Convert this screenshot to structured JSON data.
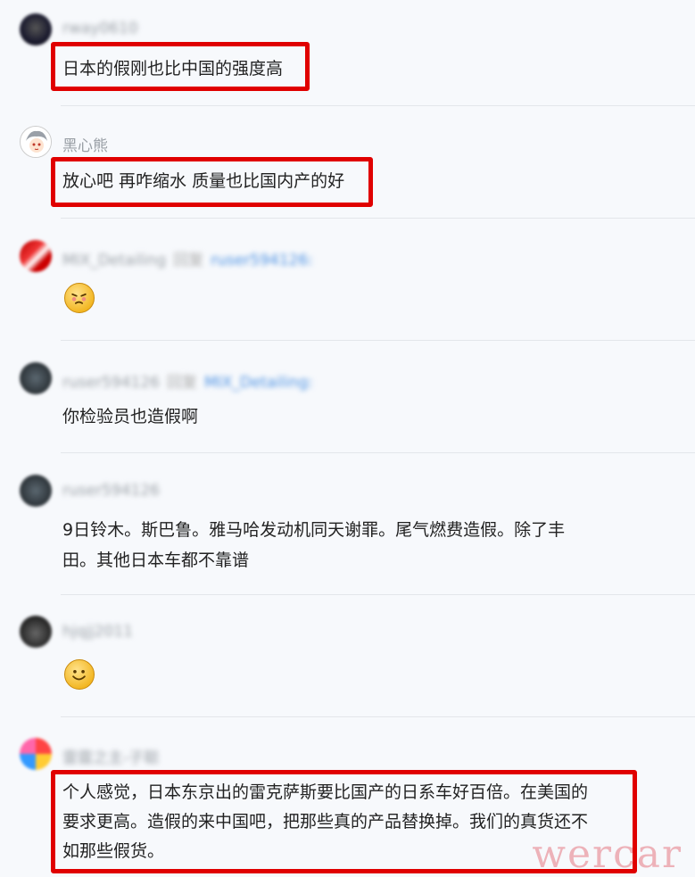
{
  "comments": [
    {
      "username": "rway0610",
      "text": "日本的假刚也比中国的强度高"
    },
    {
      "username": "黑心熊",
      "text": "放心吧 再咋缩水 质量也比国内产的好"
    },
    {
      "username": "MIX_Detailing",
      "reply_label": "回复",
      "reply_to": "ruser594126:",
      "emoji": "angry-face-emoji"
    },
    {
      "username": "ruser594126",
      "reply_label": "回复",
      "reply_to": "MIX_Detailing:",
      "text": "你检验员也造假啊"
    },
    {
      "username": "ruser594126",
      "text_line1": "9日铃木。斯巴鲁。雅马哈发动机同天谢罪。尾气燃费造假。除了丰",
      "text_line2": "田。其他日本车都不靠谱"
    },
    {
      "username": "hjqjj2011",
      "emoji": "smile-face-emoji"
    },
    {
      "username": "雷霆之主-子聪",
      "text_line1": "个人感觉，日本东京出的雷克萨斯要比国产的日系车好百倍。在美国的",
      "text_line2": "要求更高。造假的来中国吧，把那些真的产品替换掉。我们的真货还不",
      "text_line3": "如那些假货。"
    }
  ],
  "watermark": "wercar",
  "colors": {
    "highlight_box": "#e00000",
    "reply_link": "#4a90e2"
  }
}
